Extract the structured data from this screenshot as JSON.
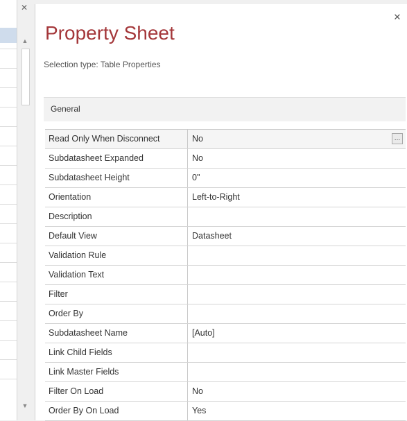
{
  "panel": {
    "title": "Property Sheet",
    "selection_type": "Selection type:  Table Properties",
    "tab": "General"
  },
  "properties": [
    {
      "name": "Read Only When Disconnect",
      "value": "No"
    },
    {
      "name": "Subdatasheet Expanded",
      "value": "No"
    },
    {
      "name": "Subdatasheet Height",
      "value": "0\""
    },
    {
      "name": "Orientation",
      "value": "Left-to-Right"
    },
    {
      "name": "Description",
      "value": ""
    },
    {
      "name": "Default View",
      "value": "Datasheet"
    },
    {
      "name": "Validation Rule",
      "value": ""
    },
    {
      "name": "Validation Text",
      "value": ""
    },
    {
      "name": "Filter",
      "value": ""
    },
    {
      "name": "Order By",
      "value": ""
    },
    {
      "name": "Subdatasheet Name",
      "value": "[Auto]"
    },
    {
      "name": "Link Child Fields",
      "value": ""
    },
    {
      "name": "Link Master Fields",
      "value": ""
    },
    {
      "name": "Filter On Load",
      "value": "No"
    },
    {
      "name": "Order By On Load",
      "value": "Yes"
    }
  ],
  "icons": {
    "close": "close-icon",
    "builder": "ellipsis-button",
    "scroll_up": "chevron-up-icon",
    "scroll_down": "chevron-down-icon"
  }
}
